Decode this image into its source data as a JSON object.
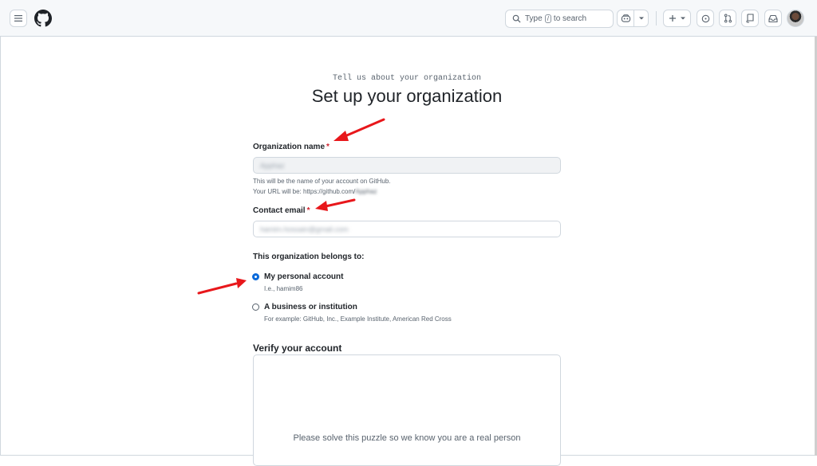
{
  "header": {
    "menu_icon": "hamburger-icon",
    "logo_icon": "github-logo-icon",
    "search": {
      "prefix": "Type",
      "key": "/",
      "suffix": "to search"
    },
    "copilot_icon": "copilot-icon",
    "create_icon": "plus-icon",
    "issues_icon": "issue-opened-icon",
    "pulls_icon": "git-pull-request-icon",
    "repos_icon": "repo-icon",
    "inbox_icon": "inbox-icon"
  },
  "page": {
    "eyebrow": "Tell us about your organization",
    "title": "Set up your organization"
  },
  "form": {
    "org_name": {
      "label": "Organization name",
      "required_mark": "*",
      "value": "Apphaz",
      "hint_line1": "This will be the name of your account on GitHub.",
      "hint_line2_prefix": "Your URL will be: https://github.com/",
      "hint_line2_value": "Apphaz"
    },
    "contact_email": {
      "label": "Contact email",
      "required_mark": "*",
      "value": "hamim.hossain@gmail.com"
    },
    "belongs_to": {
      "label": "This organization belongs to:",
      "options": [
        {
          "label": "My personal account",
          "hint": "I.e., hamim86",
          "checked": true
        },
        {
          "label": "A business or institution",
          "hint": "For example: GitHub, Inc., Example Institute, American Red Cross",
          "checked": false
        }
      ]
    },
    "verify": {
      "title": "Verify your account",
      "captcha_text": "Please solve this puzzle so we know you are a real person"
    }
  },
  "colors": {
    "accent": "#0969da",
    "required": "#cf222e",
    "annotation_arrow": "#e8171b"
  }
}
